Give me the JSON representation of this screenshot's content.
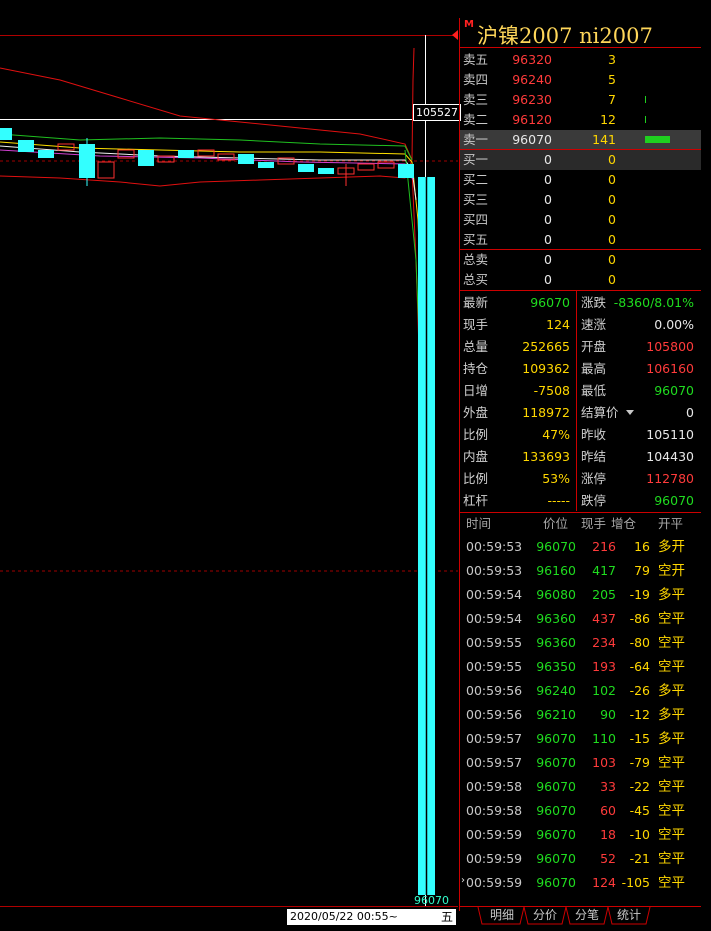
{
  "title": {
    "marker": "M",
    "text": "沪镍2007  ni2007"
  },
  "axis": {
    "price_tag": "105527",
    "last_price_tag": "96070",
    "date_label": "2020/05/22 00:55~",
    "weekday": "五"
  },
  "orderbook": {
    "asks": [
      {
        "label": "卖五",
        "price": "96320",
        "vol": "3",
        "depth": 0
      },
      {
        "label": "卖四",
        "price": "96240",
        "vol": "5",
        "depth": 0
      },
      {
        "label": "卖三",
        "price": "96230",
        "vol": "7",
        "depth": 0.02
      },
      {
        "label": "卖二",
        "price": "96120",
        "vol": "12",
        "depth": 0.02
      },
      {
        "label": "卖一",
        "price": "96070",
        "vol": "141",
        "depth": 0.5
      }
    ],
    "bids": [
      {
        "label": "买一",
        "price": "0",
        "vol": "0"
      },
      {
        "label": "买二",
        "price": "0",
        "vol": "0"
      },
      {
        "label": "买三",
        "price": "0",
        "vol": "0"
      },
      {
        "label": "买四",
        "price": "0",
        "vol": "0"
      },
      {
        "label": "买五",
        "price": "0",
        "vol": "0"
      }
    ],
    "totals": [
      {
        "label": "总卖",
        "price": "0",
        "vol": "0"
      },
      {
        "label": "总买",
        "price": "0",
        "vol": "0"
      }
    ]
  },
  "stats_left": [
    {
      "label": "最新",
      "value": "96070",
      "color": "#1fdc1f"
    },
    {
      "label": "现手",
      "value": "124",
      "color": "#ffd700"
    },
    {
      "label": "总量",
      "value": "252665",
      "color": "#ffd700"
    },
    {
      "label": "持仓",
      "value": "109362",
      "color": "#ffd700"
    },
    {
      "label": "日增",
      "value": "-7508",
      "color": "#ffd700"
    },
    {
      "label": "外盘",
      "value": "118972",
      "color": "#ffd700"
    },
    {
      "label": "比例",
      "value": "47%",
      "color": "#ffd700"
    },
    {
      "label": "内盘",
      "value": "133693",
      "color": "#ffd700"
    },
    {
      "label": "比例",
      "value": "53%",
      "color": "#ffd700"
    },
    {
      "label": "杠杆",
      "value": "-----",
      "color": "#ffd700"
    }
  ],
  "stats_right": [
    {
      "label": "涨跌",
      "value": "-8360/8.01%",
      "color": "#1fdc1f"
    },
    {
      "label": "速涨",
      "value": "0.00%",
      "color": "#e8e8e8"
    },
    {
      "label": "开盘",
      "value": "105800",
      "color": "#ff3b3b"
    },
    {
      "label": "最高",
      "value": "106160",
      "color": "#ff3b3b"
    },
    {
      "label": "最低",
      "value": "96070",
      "color": "#1fdc1f"
    },
    {
      "label": "结算价",
      "value": "0",
      "color": "#e8e8e8"
    },
    {
      "label": "昨收",
      "value": "105110",
      "color": "#e8e8e8"
    },
    {
      "label": "昨结",
      "value": "104430",
      "color": "#e8e8e8"
    },
    {
      "label": "涨停",
      "value": "112780",
      "color": "#ff3b3b"
    },
    {
      "label": "跌停",
      "value": "96070",
      "color": "#1fdc1f"
    }
  ],
  "ticks_header": {
    "time": "时间",
    "price": "价位",
    "vol": "现手",
    "chg": "增仓",
    "kind": "开平"
  },
  "ticks": [
    {
      "time": "00:59:53",
      "price": "96070",
      "vol": "216",
      "vcolor": "#ff3b3b",
      "chg": "16",
      "kind": "多开"
    },
    {
      "time": "00:59:53",
      "price": "96160",
      "vol": "417",
      "vcolor": "#1fdc1f",
      "chg": "79",
      "kind": "空开"
    },
    {
      "time": "00:59:54",
      "price": "96080",
      "vol": "205",
      "vcolor": "#1fdc1f",
      "chg": "-19",
      "kind": "多平"
    },
    {
      "time": "00:59:54",
      "price": "96360",
      "vol": "437",
      "vcolor": "#ff3b3b",
      "chg": "-86",
      "kind": "空平"
    },
    {
      "time": "00:59:55",
      "price": "96360",
      "vol": "234",
      "vcolor": "#ff3b3b",
      "chg": "-80",
      "kind": "空平"
    },
    {
      "time": "00:59:55",
      "price": "96350",
      "vol": "193",
      "vcolor": "#ff3b3b",
      "chg": "-64",
      "kind": "空平"
    },
    {
      "time": "00:59:56",
      "price": "96240",
      "vol": "102",
      "vcolor": "#1fdc1f",
      "chg": "-26",
      "kind": "多平"
    },
    {
      "time": "00:59:56",
      "price": "96210",
      "vol": "90",
      "vcolor": "#1fdc1f",
      "chg": "-12",
      "kind": "多平"
    },
    {
      "time": "00:59:57",
      "price": "96070",
      "vol": "110",
      "vcolor": "#1fdc1f",
      "chg": "-15",
      "kind": "多平"
    },
    {
      "time": "00:59:57",
      "price": "96070",
      "vol": "103",
      "vcolor": "#ff3b3b",
      "chg": "-79",
      "kind": "空平"
    },
    {
      "time": "00:59:58",
      "price": "96070",
      "vol": "33",
      "vcolor": "#ff3b3b",
      "chg": "-22",
      "kind": "空平"
    },
    {
      "time": "00:59:58",
      "price": "96070",
      "vol": "60",
      "vcolor": "#ff3b3b",
      "chg": "-45",
      "kind": "空平"
    },
    {
      "time": "00:59:59",
      "price": "96070",
      "vol": "18",
      "vcolor": "#ff3b3b",
      "chg": "-10",
      "kind": "空平"
    },
    {
      "time": "00:59:59",
      "price": "96070",
      "vol": "52",
      "vcolor": "#ff3b3b",
      "chg": "-21",
      "kind": "空平"
    },
    {
      "time": "00:59:59",
      "price": "96070",
      "vol": "124",
      "vcolor": "#ff3b3b",
      "chg": "-105",
      "kind": "空平"
    }
  ],
  "tabs": [
    "明细",
    "分价",
    "分笔",
    "统计"
  ]
}
